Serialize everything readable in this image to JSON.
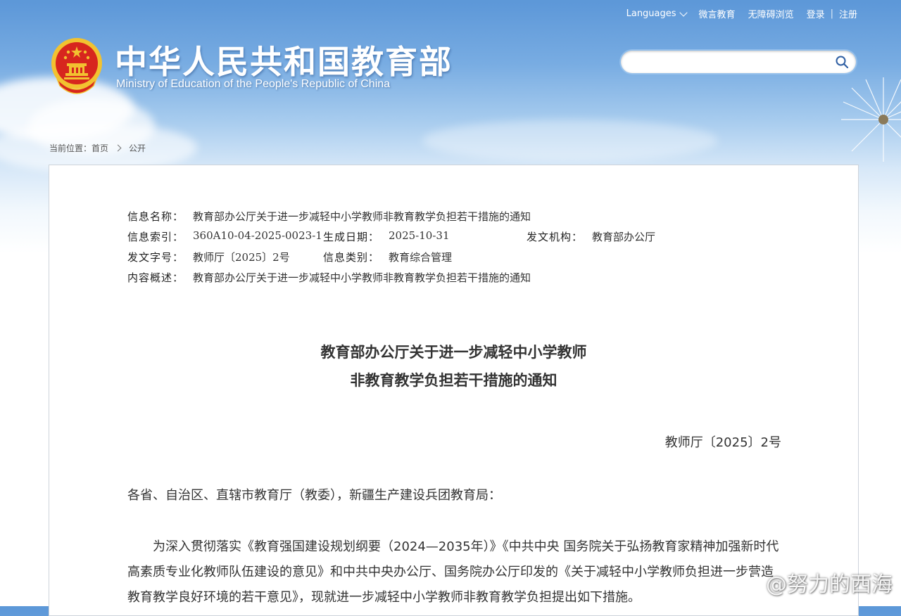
{
  "header": {
    "links": {
      "languages": "Languages",
      "weiyan": "微言教育",
      "accessible": "无障碍浏览",
      "login": "登录",
      "register": "注册"
    },
    "site_name_cn": "中华人民共和国教育部",
    "site_name_en": "Ministry of Education of the People's Republic of China",
    "search_placeholder": ""
  },
  "breadcrumb": {
    "prefix": "当前位置：",
    "items": [
      "首页",
      "公开"
    ]
  },
  "meta": {
    "name_label": "信息名称：",
    "name_value": "教育部办公厅关于进一步减轻中小学教师非教育教学负担若干措施的通知",
    "index_label": "信息索引：",
    "index_value": "360A10-04-2025-0023-1",
    "date_label": "生成日期：",
    "date_value": "2025-10-31",
    "org_label": "发文机构：",
    "org_value": "教育部办公厅",
    "docno_label": "发文字号：",
    "docno_value": "教师厅〔2025〕2号",
    "category_label": "信息类别：",
    "category_value": "教育综合管理",
    "summary_label": "内容概述：",
    "summary_value": "教育部办公厅关于进一步减轻中小学教师非教育教学负担若干措施的通知"
  },
  "document": {
    "title_line1": "教育部办公厅关于进一步减轻中小学教师",
    "title_line2": "非教育教学负担若干措施的通知",
    "doc_number": "教师厅〔2025〕2号",
    "salutation": "各省、自治区、直辖市教育厅（教委），新疆生产建设兵团教育局：",
    "paragraph1": "为深入贯彻落实《教育强国建设规划纲要（2024—2035年）》《中共中央 国务院关于弘扬教育家精神加强新时代高素质专业化教师队伍建设的意见》和中共中央办公厅、国务院办公厅印发的《关于减轻中小学教师负担进一步营造教育教学良好环境的若干意见》，现就进一步减轻中小学教师非教育教学负担提出如下措施。"
  },
  "watermark": {
    "text": "@努力的西海",
    "icon": "weibo-icon"
  },
  "colors": {
    "sky_top": "#5c97d8",
    "emblem_red": "#d7261e",
    "emblem_gold": "#f2c230"
  }
}
